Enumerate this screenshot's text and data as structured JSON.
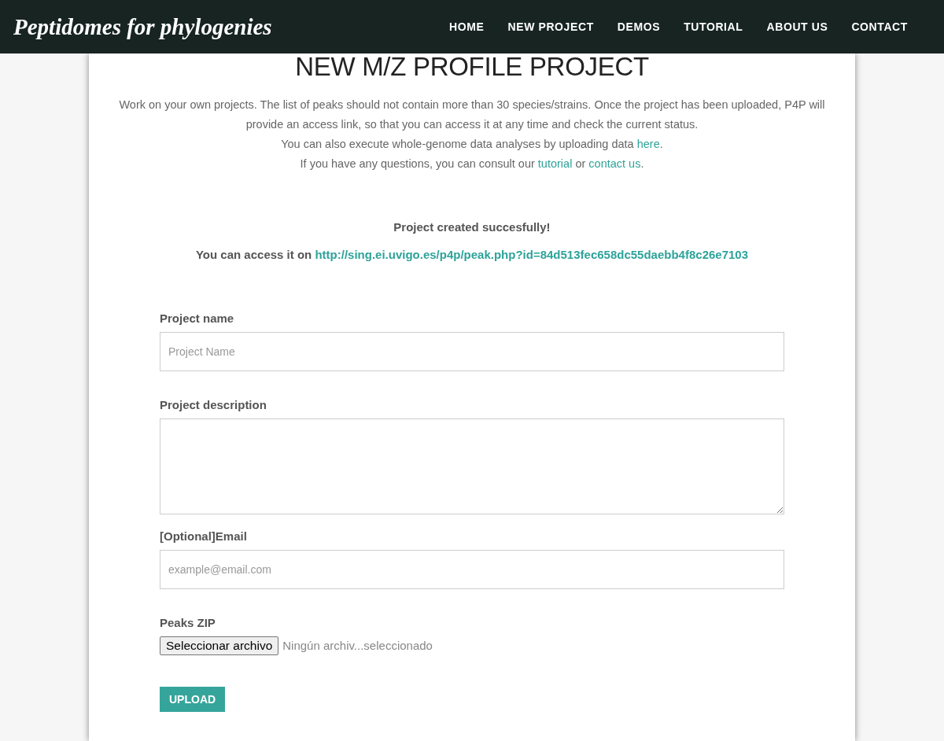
{
  "navbar": {
    "logo": "Peptidomes for phylogenies",
    "items": [
      {
        "label": "HOME"
      },
      {
        "label": "NEW PROJECT"
      },
      {
        "label": "DEMOS"
      },
      {
        "label": "TUTORIAL"
      },
      {
        "label": "ABOUT US"
      },
      {
        "label": "CONTACT"
      }
    ]
  },
  "header": {
    "title": "NEW M/Z PROFILE PROJECT",
    "intro": [
      {
        "segments": [
          {
            "kind": "text",
            "text": "Work on your own projects. The list of peaks should not contain more than 30 species/strains. Once the project has been uploaded, P4P will provide an access link, so that you can access it at any time and check the current status."
          }
        ]
      },
      {
        "segments": [
          {
            "kind": "text",
            "text": "You can also execute whole-genome data analyses by uploading data "
          },
          {
            "kind": "link",
            "text": "here"
          },
          {
            "kind": "text",
            "text": "."
          }
        ]
      },
      {
        "segments": [
          {
            "kind": "text",
            "text": "If you have any questions, you can consult our "
          },
          {
            "kind": "link",
            "text": "tutorial"
          },
          {
            "kind": "text",
            "text": " or "
          },
          {
            "kind": "link",
            "text": "contact us"
          },
          {
            "kind": "text",
            "text": "."
          }
        ]
      }
    ]
  },
  "notice": {
    "message": "Project created succesfully!",
    "access_label": "You can access it on",
    "access_link": "http://sing.ei.uvigo.es/p4p/peak.php?id=84d513fec658dc55daebb4f8c26e7103"
  },
  "form": {
    "fields": [
      {
        "kind": "text",
        "label": "Project name",
        "placeholder": "Project Name"
      },
      {
        "kind": "textarea",
        "label": "Project description"
      },
      {
        "kind": "text",
        "label": "[Optional]Email",
        "placeholder": "example@email.com"
      },
      {
        "kind": "file",
        "label": "Peaks ZIP",
        "button": "Seleccionar archivo",
        "status": "Ningún archiv...seleccionado"
      }
    ],
    "submit": "UPLOAD"
  }
}
